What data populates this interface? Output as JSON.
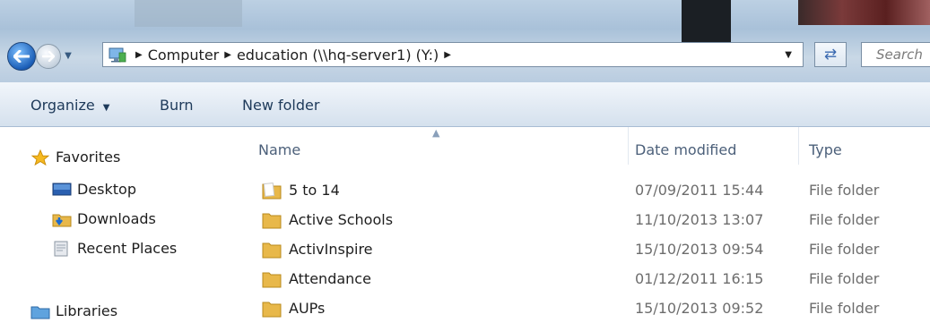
{
  "address_bar": {
    "crumbs": [
      "Computer",
      "education (\\\\hq-server1) (Y:)"
    ],
    "search_placeholder": "Search"
  },
  "toolbar": {
    "organize_label": "Organize",
    "burn_label": "Burn",
    "new_folder_label": "New folder"
  },
  "nav": {
    "favorites_label": "Favorites",
    "items": [
      {
        "label": "Desktop",
        "icon": "desktop-icon"
      },
      {
        "label": "Downloads",
        "icon": "downloads-icon"
      },
      {
        "label": "Recent Places",
        "icon": "recent-places-icon"
      }
    ],
    "libraries_label": "Libraries"
  },
  "columns": {
    "name": "Name",
    "date": "Date modified",
    "type": "Type"
  },
  "files": [
    {
      "name": "5 to 14",
      "date": "07/09/2011 15:44",
      "type": "File folder"
    },
    {
      "name": "Active Schools",
      "date": "11/10/2013 13:07",
      "type": "File folder"
    },
    {
      "name": "ActivInspire",
      "date": "15/10/2013 09:54",
      "type": "File folder"
    },
    {
      "name": "Attendance",
      "date": "01/12/2011 16:15",
      "type": "File folder"
    },
    {
      "name": "AUPs",
      "date": "15/10/2013 09:52",
      "type": "File folder"
    }
  ],
  "colors": {
    "folder": "#e8b84a",
    "accent": "#1b5eb7"
  }
}
